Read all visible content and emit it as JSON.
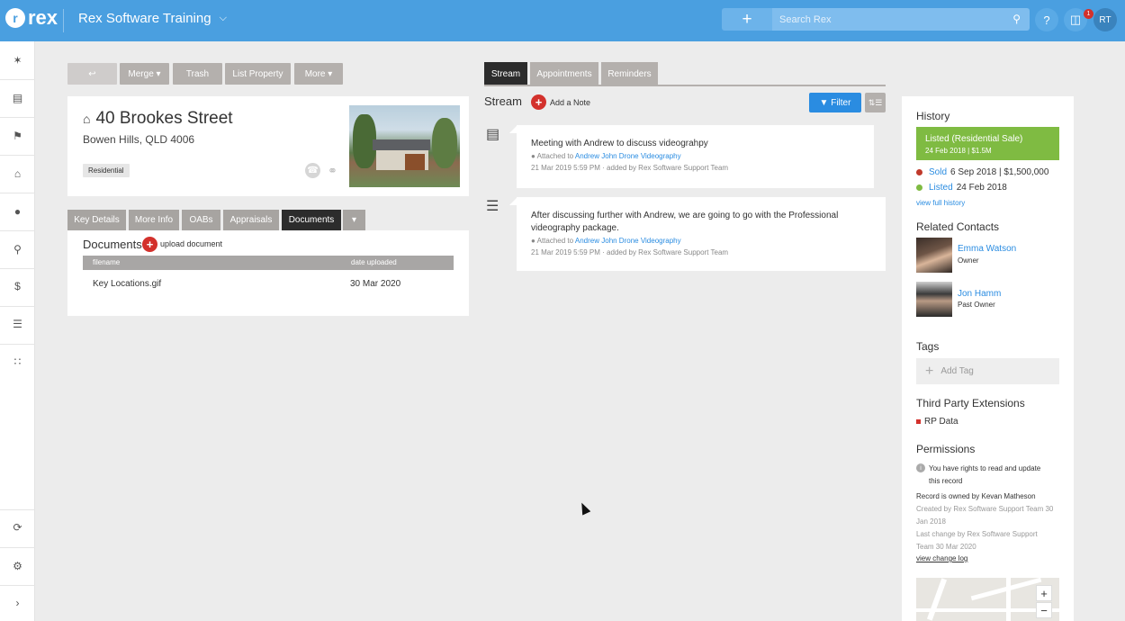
{
  "topbar": {
    "logo_text": "rex",
    "account_name": "Rex Software Training",
    "search_placeholder": "Search Rex",
    "help_label": "?",
    "notifications_count": "1",
    "user_initials": "RT"
  },
  "actions": {
    "merge": "Merge",
    "trash": "Trash",
    "list_property": "List Property",
    "more": "More"
  },
  "property": {
    "address": "40 Brookes Street",
    "suburb": "Bowen Hills, QLD 4006",
    "type_badge": "Residential"
  },
  "detail_tabs": [
    "Key Details",
    "More Info",
    "OABs",
    "Appraisals",
    "Documents"
  ],
  "documents": {
    "title": "Documents",
    "upload_label": "upload document",
    "columns": [
      "filename",
      "date uploaded"
    ],
    "rows": [
      {
        "filename": "Key Locations.gif",
        "date": "30 Mar 2020"
      }
    ]
  },
  "stream": {
    "tabs": [
      "Stream",
      "Appointments",
      "Reminders"
    ],
    "title": "Stream",
    "add_note": "Add a Note",
    "filter": "Filter",
    "entries": [
      {
        "text": "Meeting with Andrew to discuss videograhpy",
        "attached_prefix": "Attached to",
        "attached_link": "Andrew John Drone Videography",
        "meta": "21 Mar 2019 5:59 PM · added by Rex Software Support Team"
      },
      {
        "text": "After discussing further with Andrew, we are going to go with the Professional videography package.",
        "attached_prefix": "Attached to",
        "attached_link": "Andrew John Drone Videography",
        "meta": "21 Mar 2019 5:59 PM · added by Rex Software Support Team"
      }
    ]
  },
  "history": {
    "title": "History",
    "listed_box_title": "Listed (Residential Sale)",
    "listed_box_detail": "24 Feb 2018 | $1.5M",
    "rows": [
      {
        "status": "Sold",
        "detail": "6 Sep 2018 | $1,500,000",
        "color": "#c0392b"
      },
      {
        "status": "Listed",
        "detail": "24 Feb 2018",
        "color": "#7fbb42"
      }
    ],
    "view_full": "view full history"
  },
  "related_contacts": {
    "title": "Related Contacts",
    "contacts": [
      {
        "name": "Emma Watson",
        "role": "Owner"
      },
      {
        "name": "Jon Hamm",
        "role": "Past Owner"
      }
    ]
  },
  "tags": {
    "title": "Tags",
    "add_tag": "Add Tag"
  },
  "extensions": {
    "title": "Third Party Extensions",
    "items": [
      "RP Data"
    ]
  },
  "permissions": {
    "title": "Permissions",
    "rights_line1": "You have rights to read and update",
    "rights_line2": "this record",
    "owned_prefix": "Record is owned by",
    "owner": "Kevan Matheson",
    "created_line1": "Created by Rex Software Support Team 30",
    "created_line2": "Jan 2018",
    "changed_line1": "Last change by Rex Software Support",
    "changed_line2": "Team 30 Mar 2020",
    "change_log": "view change log"
  },
  "map": {
    "zoom_in": "+",
    "zoom_out": "−"
  },
  "colors": {
    "topbar": "#4a9fe0",
    "accent_blue": "#2a8ce1",
    "listed_green": "#7fbb42",
    "red": "#d3312c"
  }
}
